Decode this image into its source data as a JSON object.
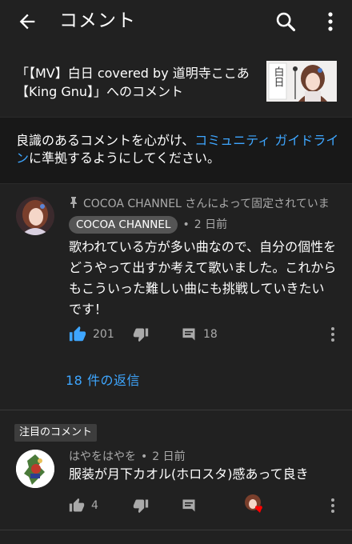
{
  "appbar": {
    "title": "コメント",
    "back_icon": "arrow-left-icon",
    "search_icon": "search-icon",
    "more_icon": "more-vert-icon"
  },
  "video": {
    "title": "「【MV】白日 covered by 道明寺ここあ【King Gnu】」へのコメント",
    "thumbnail_text": "白日"
  },
  "guideline": {
    "before": "良識のあるコメントを心がけ、",
    "link": "コミュニティ ガイドライン",
    "after": "に準拠するようにしてください。"
  },
  "pinned_comment": {
    "pinned_label": "COCOA CHANNEL さんによって固定されていま",
    "author": "COCOA CHANNEL",
    "time": "2 日前",
    "text": "歌われている方が多い曲なので、自分の個性をどうやって出すか考えて歌いました。これからもこういった難しい曲にも挑戦していきたいです！",
    "likes": "201",
    "replies_count": "18",
    "replies_link": "18 件の返信"
  },
  "featured": {
    "badge": "注目のコメント",
    "author": "はやをはやを",
    "time": "2 日前",
    "text": "服装が月下カオル(ホロスタ)感あって良き",
    "likes": "4"
  },
  "colors": {
    "background": "#212121",
    "accent": "#3ea6ff",
    "secondary_text": "#aaaaaa",
    "heart": "#ff0000"
  }
}
